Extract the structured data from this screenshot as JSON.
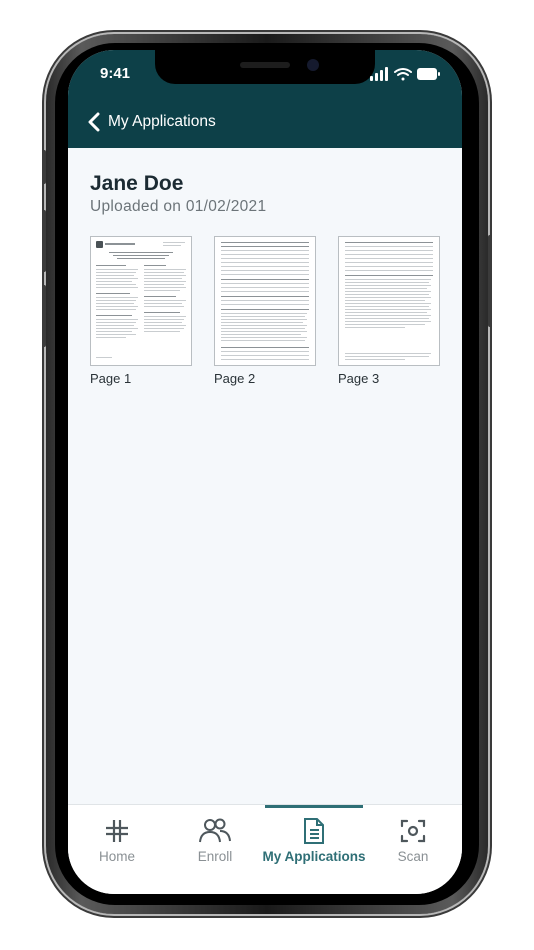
{
  "status_bar": {
    "time": "9:41"
  },
  "header": {
    "back_label": "My Applications"
  },
  "applicant": {
    "name": "Jane Doe",
    "uploaded": "Uploaded on 01/02/2021"
  },
  "pages": [
    {
      "label": "Page 1"
    },
    {
      "label": "Page 2"
    },
    {
      "label": "Page 3"
    }
  ],
  "tabs": [
    {
      "label": "Home",
      "icon": "home-icon",
      "active": false
    },
    {
      "label": "Enroll",
      "icon": "users-icon",
      "active": false
    },
    {
      "label": "My Applications",
      "icon": "document-icon",
      "active": true
    },
    {
      "label": "Scan",
      "icon": "scan-icon",
      "active": false
    }
  ],
  "colors": {
    "header": "#0d4048",
    "accent": "#2f6f76",
    "background": "#f5f8fb"
  }
}
